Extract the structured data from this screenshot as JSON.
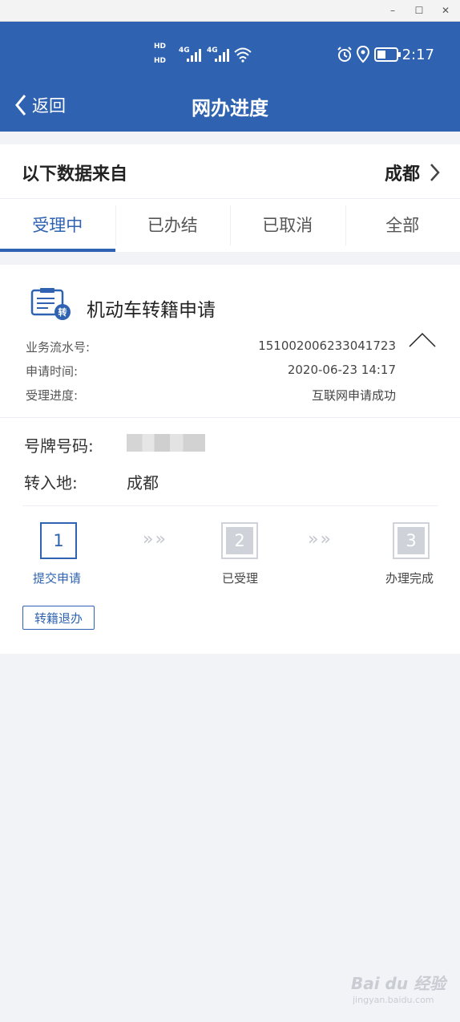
{
  "window": {
    "min": "–",
    "max": "☐",
    "close": "✕"
  },
  "status": {
    "time": "2:17",
    "hd1": "HD",
    "hd2": "HD",
    "net1": "4G",
    "net2": "4G"
  },
  "nav": {
    "back_label": "返回",
    "title": "网办进度"
  },
  "source": {
    "label": "以下数据来自",
    "city": "成都"
  },
  "tabs": [
    {
      "label": "受理中",
      "active": true
    },
    {
      "label": "已办结",
      "active": false
    },
    {
      "label": "已取消",
      "active": false
    },
    {
      "label": "全部",
      "active": false
    }
  ],
  "card": {
    "icon_badge": "转",
    "title": "机动车转籍申请",
    "meta": [
      {
        "label": "业务流水号:",
        "value": "151002006233041723"
      },
      {
        "label": "申请时间:",
        "value": "2020-06-23 14:17"
      },
      {
        "label": "受理进度:",
        "value": "互联网申请成功"
      }
    ],
    "fields": {
      "plate_label": "号牌号码:",
      "dest_label": "转入地:",
      "dest_value": "成都"
    },
    "steps": [
      {
        "num": "1",
        "label": "提交申请",
        "active": true
      },
      {
        "num": "2",
        "label": "已受理",
        "active": false
      },
      {
        "num": "3",
        "label": "办理完成",
        "active": false
      }
    ],
    "chevrons": "»»",
    "cancel_button": "转籍退办"
  },
  "watermark": {
    "text": "Bai du 经验",
    "sub": "jingyan.baidu.com"
  }
}
